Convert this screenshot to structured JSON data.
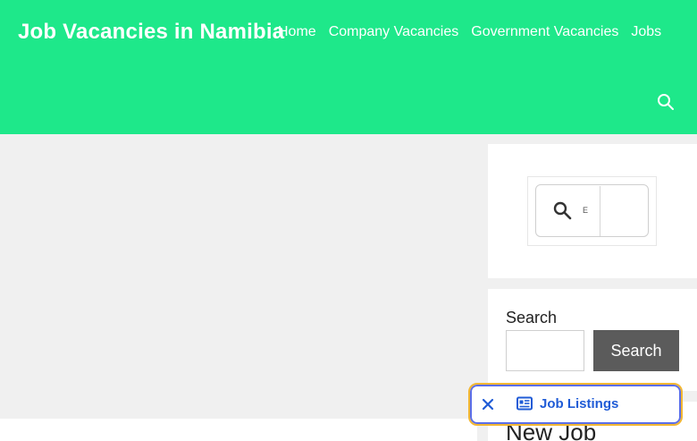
{
  "header": {
    "site_title": "Job Vacancies in Namibia",
    "background_color": "#1ee88a",
    "nav": [
      {
        "label": "Home"
      },
      {
        "label": "Company Vacancies"
      },
      {
        "label": "Government Vacancies"
      },
      {
        "label": "Jobs"
      }
    ],
    "search_icon": "search-icon"
  },
  "sidebar": {
    "search_widget": {
      "input_value": "E",
      "icon": "search-icon"
    },
    "search_form": {
      "label": "Search",
      "button_label": "Search",
      "input_value": ""
    },
    "latest_widget": {
      "title": "New Job"
    }
  },
  "floating_bar": {
    "label": "Job Listings",
    "close_icon": "close-icon",
    "listing_icon": "listing-icon",
    "accent_color": "#1f5bd6",
    "border_color": "#f2b733"
  }
}
